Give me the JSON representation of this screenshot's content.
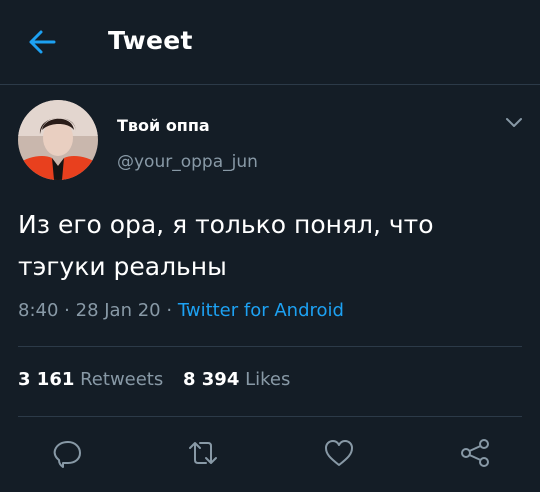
{
  "header": {
    "title": "Tweet",
    "back_icon": "arrow-left-icon"
  },
  "author": {
    "display_name": "Твой оппа",
    "handle": "@your_oppa_jun"
  },
  "tweet": {
    "text_line1": "Из его ора, я только понял, что",
    "text_line2": "тэгуки реальны",
    "time": "8:40",
    "date": "28 Jan 20",
    "separator": "·",
    "source": "Twitter for Android"
  },
  "stats": {
    "retweets_count": "3 161",
    "retweets_label": "Retweets",
    "likes_count": "8 394",
    "likes_label": "Likes"
  },
  "actions": [
    "reply-icon",
    "retweet-icon",
    "like-icon",
    "share-icon"
  ],
  "colors": {
    "background": "#141d26",
    "accent": "#1da1f2",
    "secondary_text": "#8899a6",
    "divider": "#2c3a48"
  }
}
